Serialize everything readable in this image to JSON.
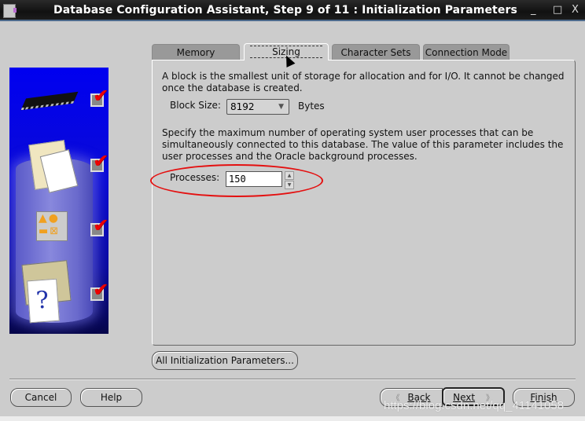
{
  "window": {
    "title": "Database Configuration Assistant, Step 9 of 11 : Initialization Parameters",
    "controls": {
      "minimize": "_",
      "maximize": "□",
      "close": "X"
    }
  },
  "side_panel": {
    "images": [
      "memory-chip",
      "database-documents",
      "shapes-storage",
      "help-folders"
    ],
    "checkmarks": [
      "✔",
      "✔",
      "✔",
      "✔"
    ]
  },
  "tabs": [
    {
      "label": "Memory",
      "active": false
    },
    {
      "label": "Sizing",
      "active": true
    },
    {
      "label": "Character Sets",
      "active": false
    },
    {
      "label": "Connection Mode",
      "active": false
    }
  ],
  "sizing": {
    "block_desc": "A block is the smallest unit of storage for allocation and for I/O. It cannot be changed once the database is created.",
    "block_size_label": "Block Size:",
    "block_size_value": "8192",
    "block_size_arrow": "▼",
    "block_size_unit": "Bytes",
    "processes_desc": "Specify the maximum number of operating system user processes that can be simultaneously connected to this database. The value of this parameter includes the user processes and the Oracle background processes.",
    "processes_label": "Processes:",
    "processes_value": "150",
    "spin_up": "▲",
    "spin_down": "▼"
  },
  "buttons": {
    "all_params": "All Initialization Parameters...",
    "cancel": "Cancel",
    "help": "Help",
    "back_arrow": "《",
    "back": "Back",
    "next": "Next",
    "next_arrow": "》",
    "finish": "Finish"
  },
  "watermark": "https://blog.csdn.net/qq_41141058",
  "colors": {
    "annotation_ellipse": "#e41010",
    "side_panel_blue": "#0000f0",
    "checkmark_red": "#e00000"
  }
}
